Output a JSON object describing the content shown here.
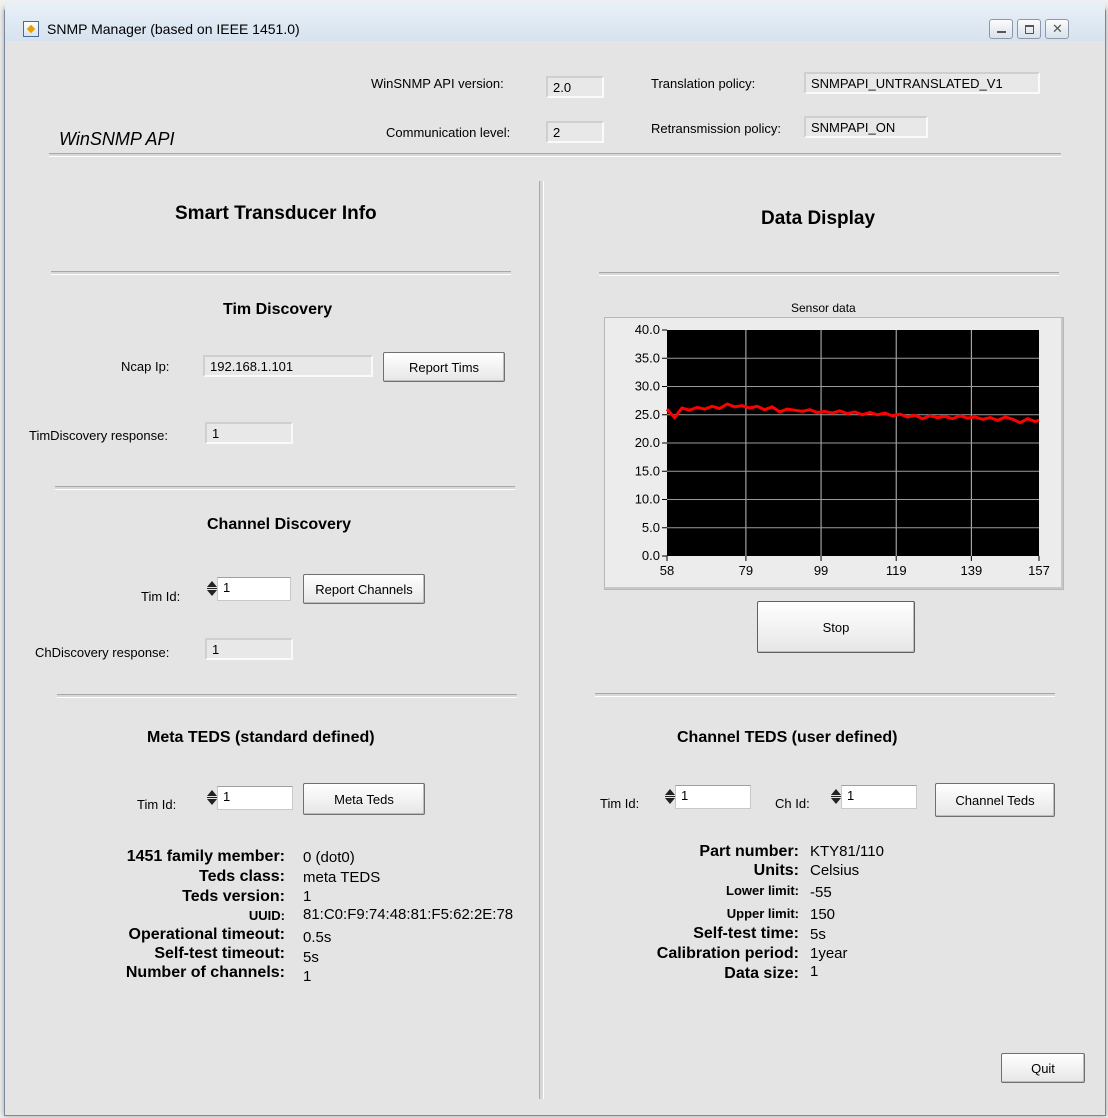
{
  "window": {
    "title": "SNMP Manager (based on IEEE 1451.0)",
    "icon": "app-icon",
    "controls": [
      "minimize-icon",
      "maximize-icon",
      "close-icon"
    ]
  },
  "api": {
    "brand": "WinSNMP API",
    "version_label": "WinSNMP API version:",
    "version_value": "2.0",
    "comm_label": "Communication level:",
    "comm_value": "2",
    "translation_label": "Translation policy:",
    "translation_value": "SNMPAPI_UNTRANSLATED_V1",
    "retransmission_label": "Retransmission policy:",
    "retransmission_value": "SNMPAPI_ON"
  },
  "left": {
    "title": "Smart Transducer Info",
    "tim_discovery": {
      "title": "Tim Discovery",
      "ncap_label": "Ncap Ip:",
      "ncap_value": "192.168.1.101",
      "button": "Report Tims",
      "response_label": "TimDiscovery response:",
      "response_value": "1"
    },
    "channel_discovery": {
      "title": "Channel Discovery",
      "tim_label": "Tim Id:",
      "tim_value": "1",
      "button": "Report Channels",
      "response_label": "ChDiscovery response:",
      "response_value": "1"
    },
    "meta_teds": {
      "title": "Meta TEDS (standard defined)",
      "tim_label": "Tim Id:",
      "tim_value": "1",
      "button": "Meta Teds",
      "rows": [
        {
          "key": "1451 family member:",
          "value": "0 (dot0)"
        },
        {
          "key": "Teds class:",
          "value": "meta TEDS"
        },
        {
          "key": "Teds version:",
          "value": "1"
        },
        {
          "key": "UUID:",
          "value": "81:C0:F9:74:48:81:F5:62:2E:78"
        },
        {
          "key": "Operational timeout:",
          "value": "0.5s"
        },
        {
          "key": "Self-test timeout:",
          "value": "5s"
        },
        {
          "key": "Number of channels:",
          "value": "1"
        }
      ]
    }
  },
  "right": {
    "title": "Data Display",
    "stop_button": "Stop",
    "channel_teds": {
      "title": "Channel TEDS (user defined)",
      "tim_label": "Tim Id:",
      "tim_value": "1",
      "ch_label": "Ch Id:",
      "ch_value": "1",
      "button": "Channel Teds",
      "rows": [
        {
          "key": "Part number:",
          "value": "KTY81/110"
        },
        {
          "key": "Units:",
          "value": "Celsius"
        },
        {
          "key": "Lower limit:",
          "value": "-55"
        },
        {
          "key": "Upper limit:",
          "value": "150"
        },
        {
          "key": "Self-test time:",
          "value": "5s"
        },
        {
          "key": "Calibration period:",
          "value": "1year"
        },
        {
          "key": "Data size:",
          "value": "1"
        }
      ]
    },
    "quit_button": "Quit"
  },
  "chart_data": {
    "type": "line",
    "title": "Sensor data",
    "xlim": [
      58,
      157
    ],
    "ylim": [
      0,
      40
    ],
    "x_ticks": [
      "58",
      "79",
      "99",
      "119",
      "139",
      "157"
    ],
    "y_ticks": [
      "40.0",
      "35.0",
      "30.0",
      "25.0",
      "20.0",
      "15.0",
      "10.0",
      "5.0",
      "0.0"
    ],
    "grid": true,
    "background": "#000000",
    "series": [
      {
        "color": "#ff0000",
        "x": [
          58,
          60,
          62,
          64,
          66,
          68,
          70,
          72,
          74,
          76,
          78,
          80,
          82,
          84,
          86,
          88,
          90,
          92,
          94,
          96,
          98,
          100,
          102,
          104,
          106,
          108,
          110,
          112,
          114,
          116,
          118,
          120,
          122,
          124,
          126,
          128,
          130,
          132,
          134,
          136,
          138,
          140,
          142,
          144,
          146,
          148,
          150,
          152,
          154,
          156,
          157
        ],
        "y": [
          26.0,
          24.5,
          26.2,
          25.8,
          26.3,
          26.0,
          26.5,
          26.1,
          26.9,
          26.4,
          26.6,
          26.2,
          26.5,
          25.9,
          26.4,
          25.5,
          26.0,
          25.8,
          25.6,
          25.9,
          25.4,
          25.6,
          25.3,
          25.7,
          25.2,
          25.5,
          25.0,
          25.4,
          25.0,
          25.3,
          24.8,
          25.1,
          24.6,
          24.9,
          24.3,
          24.8,
          24.5,
          24.7,
          24.3,
          24.8,
          24.4,
          24.6,
          24.2,
          24.5,
          24.0,
          24.6,
          24.2,
          23.6,
          24.3,
          23.8,
          24.0
        ]
      }
    ]
  }
}
